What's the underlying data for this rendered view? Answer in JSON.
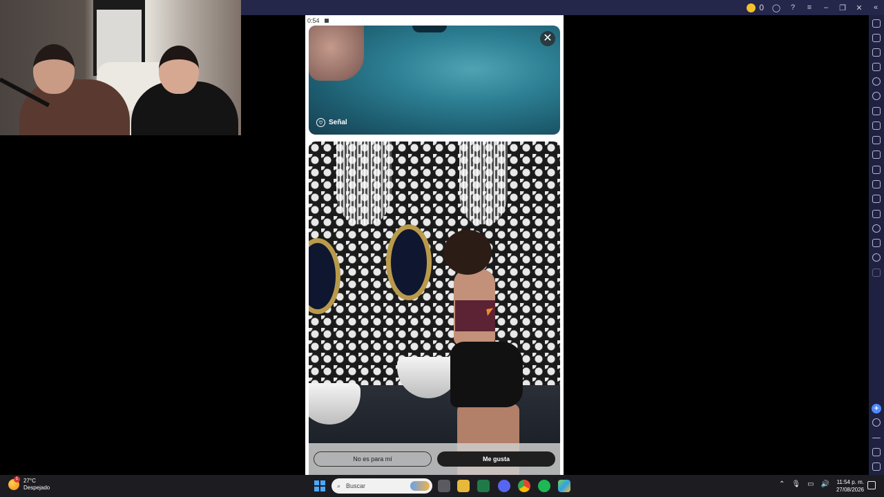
{
  "titlebar": {
    "coin_count": "0",
    "buttons": [
      "account-icon",
      "help-icon",
      "menu-icon",
      "minimize-icon",
      "restore-icon",
      "close-icon",
      "collapse-icon"
    ]
  },
  "sidebar": {
    "icons": [
      "fullscreen-icon",
      "volume-icon",
      "screen-record-icon",
      "keyboard-icon",
      "rotate-icon",
      "sync-icon",
      "apk-icon",
      "macro-icon",
      "screenshot-icon",
      "recording-icon",
      "folder-icon",
      "airplane-icon",
      "multi-instance-icon",
      "eco-icon",
      "location-icon",
      "layers-icon",
      "refresh-icon",
      "more-icon",
      "add-icon",
      "settings-icon",
      "back-icon",
      "home-icon",
      "recents-icon"
    ]
  },
  "phone": {
    "status_time": "0:54",
    "card1": {
      "label": "Señal"
    },
    "actions": {
      "reject_label": "No es para mí",
      "like_label": "Me gusta"
    }
  },
  "taskbar": {
    "weather_temp": "27°C",
    "weather_desc": "Despejado",
    "weather_badge": "1",
    "search_placeholder": "Buscar",
    "time": "11:54 p. m.",
    "date": "27/08/2026",
    "apps": [
      "task-view-icon",
      "file-explorer-icon",
      "excel-icon",
      "discord-icon",
      "chrome-icon",
      "spotify-icon",
      "bluestacks-icon"
    ],
    "colors": {
      "accent": "#4aa8ff"
    }
  }
}
